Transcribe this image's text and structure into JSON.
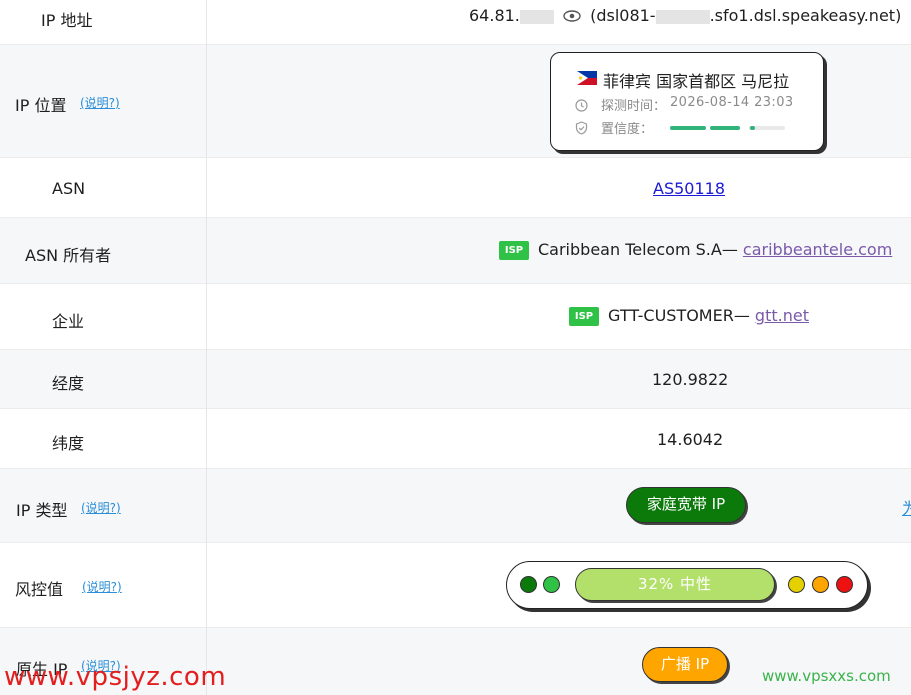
{
  "rows": {
    "ip_address": {
      "label": "IP 地址",
      "ip_prefix": "64.81.",
      "host_prefix": "(dsl081-",
      "host_suffix": ".sfo1.dsl.speakeasy.net)"
    },
    "ip_location": {
      "label": "IP 位置",
      "help": "(说明?)",
      "card": {
        "location": "菲律宾 国家首都区 马尼拉",
        "detected_label": "探测时间：",
        "detected_value": "2026-08-14 23:03",
        "confidence_label": "置信度：",
        "confidence_color": "#2fb37a"
      }
    },
    "asn": {
      "label": "ASN",
      "value": "AS50118"
    },
    "asn_owner": {
      "label": "ASN 所有者",
      "badge": "ISP",
      "name": "Caribbean Telecom S.A— ",
      "domain": "caribbeantele.com"
    },
    "enterprise": {
      "label": "企业",
      "badge": "ISP",
      "name": "GTT-CUSTOMER— ",
      "domain": "gtt.net"
    },
    "longitude": {
      "label": "经度",
      "value": "120.9822"
    },
    "latitude": {
      "label": "纬度",
      "value": "14.6042"
    },
    "ip_type": {
      "label": "IP 类型",
      "help": "(说明?)",
      "value": "家庭宽带 IP",
      "color": "#0b7a0b",
      "edge_text": "为"
    },
    "risk": {
      "label": "风控值",
      "help": "(说明?)",
      "value": "32%  中性",
      "score_percent": 32,
      "colors": {
        "dark_green": "#0b7a0b",
        "green": "#2fc247",
        "yellow": "#e6d100",
        "orange": "#ffa500",
        "red": "#ee1111",
        "bar": "#b3e06a"
      }
    },
    "native_ip": {
      "label": "原生 IP",
      "help": "(说明?)",
      "value": "广播 IP",
      "color": "#ffa500"
    }
  },
  "watermarks": {
    "left": "www.vpsjyz.com",
    "right": "www.vpsxxs.com"
  }
}
